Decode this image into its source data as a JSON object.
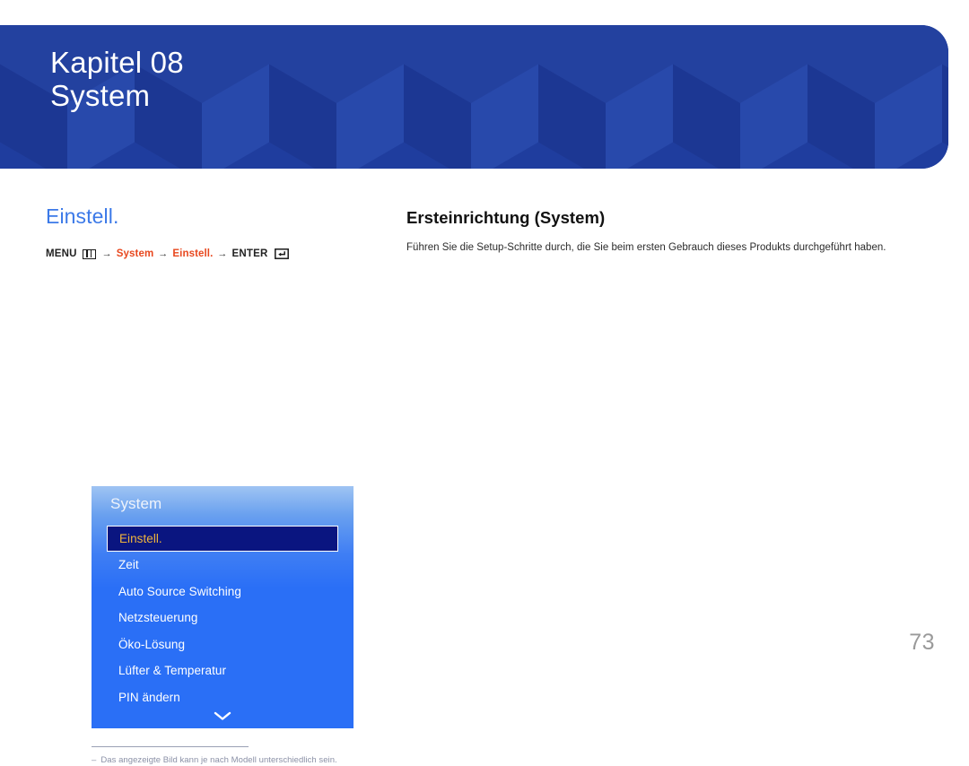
{
  "banner": {
    "chapter": "Kapitel 08",
    "title": "System",
    "bg_color": "#1f3e9e",
    "pattern": "isometric-cubes"
  },
  "left": {
    "section_title": "Einstell.",
    "section_title_color": "#3b79e8",
    "breadcrumb": {
      "menu_label": "MENU",
      "menu_icon": "menu-grid-icon",
      "arrow1": "→",
      "crumb1": "System",
      "arrow2": "→",
      "crumb2": "Einstell.",
      "arrow3": "→",
      "enter_label": "ENTER",
      "enter_icon": "enter-key-icon",
      "highlight_color": "#e8481f"
    },
    "osd": {
      "title": "System",
      "selected_index": 0,
      "selected_text_color": "#f0b43c",
      "selected_bg_color": "#0a1580",
      "panel_color": "#2a6ff6",
      "items": [
        {
          "label": "Einstell."
        },
        {
          "label": "Zeit"
        },
        {
          "label": "Auto Source Switching"
        },
        {
          "label": "Netzsteuerung"
        },
        {
          "label": "Öko-Lösung"
        },
        {
          "label": "Lüfter & Temperatur"
        },
        {
          "label": "PIN ändern"
        }
      ],
      "scroll_icon": "chevron-down-icon"
    },
    "footnote": {
      "dash": "–",
      "text": "Das angezeigte Bild kann je nach Modell unterschiedlich sein."
    }
  },
  "right": {
    "title": "Ersteinrichtung (System)",
    "body": "Führen Sie die Setup-Schritte durch, die Sie beim ersten Gebrauch dieses Produkts durchgeführt haben."
  },
  "page_number": "73"
}
